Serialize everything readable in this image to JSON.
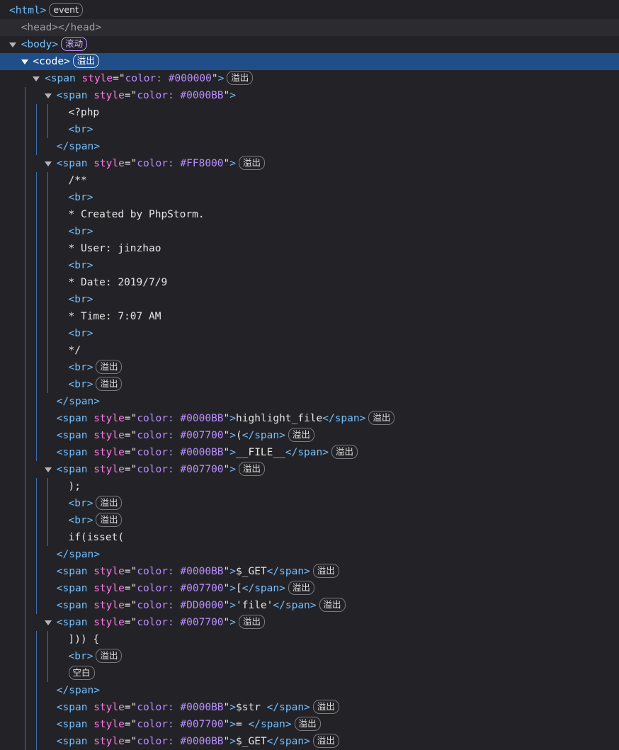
{
  "badges": {
    "event": "event",
    "scroll": "滚动",
    "overflow": "溢出",
    "whitespace": "空白"
  },
  "nodes": [
    {
      "depth": 0,
      "expand": "none",
      "kind": "open",
      "tag": "html",
      "badge": "event"
    },
    {
      "depth": 1,
      "expand": "none",
      "kind": "self",
      "tag": "head",
      "dim": true
    },
    {
      "depth": 1,
      "expand": "open",
      "kind": "open",
      "tag": "body",
      "badge": "scroll",
      "badge_purple": true
    },
    {
      "depth": 2,
      "expand": "open",
      "kind": "open",
      "tag": "code",
      "badge": "overflow",
      "selected": true
    },
    {
      "depth": 3,
      "expand": "open",
      "kind": "open",
      "tag": "span",
      "attr": "style",
      "val": "color: #000000",
      "badge": "overflow"
    },
    {
      "depth": 4,
      "expand": "open",
      "kind": "open",
      "tag": "span",
      "attr": "style",
      "val": "color: #0000BB"
    },
    {
      "depth": 5,
      "expand": "none",
      "kind": "text",
      "text": "<?php"
    },
    {
      "depth": 5,
      "expand": "none",
      "kind": "open",
      "tag": "br"
    },
    {
      "depth": 4,
      "expand": "none",
      "kind": "close",
      "tag": "span"
    },
    {
      "depth": 4,
      "expand": "open",
      "kind": "open",
      "tag": "span",
      "attr": "style",
      "val": "color: #FF8000",
      "badge": "overflow"
    },
    {
      "depth": 5,
      "expand": "none",
      "kind": "text",
      "text": "/**"
    },
    {
      "depth": 5,
      "expand": "none",
      "kind": "open",
      "tag": "br"
    },
    {
      "depth": 5,
      "expand": "none",
      "kind": "text",
      "text": " * Created by PhpStorm."
    },
    {
      "depth": 5,
      "expand": "none",
      "kind": "open",
      "tag": "br"
    },
    {
      "depth": 5,
      "expand": "none",
      "kind": "text",
      "text": " * User: jinzhao"
    },
    {
      "depth": 5,
      "expand": "none",
      "kind": "open",
      "tag": "br"
    },
    {
      "depth": 5,
      "expand": "none",
      "kind": "text",
      "text": " * Date: 2019/7/9"
    },
    {
      "depth": 5,
      "expand": "none",
      "kind": "open",
      "tag": "br"
    },
    {
      "depth": 5,
      "expand": "none",
      "kind": "text",
      "text": " * Time: 7:07 AM"
    },
    {
      "depth": 5,
      "expand": "none",
      "kind": "open",
      "tag": "br"
    },
    {
      "depth": 5,
      "expand": "none",
      "kind": "text",
      "text": " */"
    },
    {
      "depth": 5,
      "expand": "none",
      "kind": "open",
      "tag": "br",
      "badge": "overflow"
    },
    {
      "depth": 5,
      "expand": "none",
      "kind": "open",
      "tag": "br",
      "badge": "overflow"
    },
    {
      "depth": 4,
      "expand": "none",
      "kind": "close",
      "tag": "span"
    },
    {
      "depth": 4,
      "expand": "none",
      "kind": "inline",
      "tag": "span",
      "attr": "style",
      "val": "color: #0000BB",
      "inner": "highlight_file",
      "badge": "overflow"
    },
    {
      "depth": 4,
      "expand": "none",
      "kind": "inline",
      "tag": "span",
      "attr": "style",
      "val": "color: #007700",
      "inner": "(",
      "badge": "overflow"
    },
    {
      "depth": 4,
      "expand": "none",
      "kind": "inline",
      "tag": "span",
      "attr": "style",
      "val": "color: #0000BB",
      "inner": "__FILE__",
      "badge": "overflow"
    },
    {
      "depth": 4,
      "expand": "open",
      "kind": "open",
      "tag": "span",
      "attr": "style",
      "val": "color: #007700",
      "badge": "overflow"
    },
    {
      "depth": 5,
      "expand": "none",
      "kind": "text",
      "text": ");"
    },
    {
      "depth": 5,
      "expand": "none",
      "kind": "open",
      "tag": "br",
      "badge": "overflow"
    },
    {
      "depth": 5,
      "expand": "none",
      "kind": "open",
      "tag": "br",
      "badge": "overflow"
    },
    {
      "depth": 5,
      "expand": "none",
      "kind": "text",
      "text": "if(isset("
    },
    {
      "depth": 4,
      "expand": "none",
      "kind": "close",
      "tag": "span"
    },
    {
      "depth": 4,
      "expand": "none",
      "kind": "inline",
      "tag": "span",
      "attr": "style",
      "val": "color: #0000BB",
      "inner": "$_GET",
      "badge": "overflow"
    },
    {
      "depth": 4,
      "expand": "none",
      "kind": "inline",
      "tag": "span",
      "attr": "style",
      "val": "color: #007700",
      "inner": "[",
      "badge": "overflow"
    },
    {
      "depth": 4,
      "expand": "none",
      "kind": "inline",
      "tag": "span",
      "attr": "style",
      "val": "color: #DD0000",
      "inner": "'file'",
      "badge": "overflow"
    },
    {
      "depth": 4,
      "expand": "open",
      "kind": "open",
      "tag": "span",
      "attr": "style",
      "val": "color: #007700",
      "badge": "overflow"
    },
    {
      "depth": 5,
      "expand": "none",
      "kind": "text",
      "text": "])) {"
    },
    {
      "depth": 5,
      "expand": "none",
      "kind": "open",
      "tag": "br",
      "badge": "overflow"
    },
    {
      "depth": 5,
      "expand": "none",
      "kind": "badgeonly",
      "badge": "whitespace"
    },
    {
      "depth": 4,
      "expand": "none",
      "kind": "close",
      "tag": "span"
    },
    {
      "depth": 4,
      "expand": "none",
      "kind": "inline",
      "tag": "span",
      "attr": "style",
      "val": "color: #0000BB",
      "inner": "$str ",
      "badge": "overflow"
    },
    {
      "depth": 4,
      "expand": "none",
      "kind": "inline",
      "tag": "span",
      "attr": "style",
      "val": "color: #007700",
      "inner": "= ",
      "badge": "overflow"
    },
    {
      "depth": 4,
      "expand": "none",
      "kind": "inline",
      "tag": "span",
      "attr": "style",
      "val": "color: #0000BB",
      "inner": "$_GET",
      "badge": "overflow"
    }
  ]
}
